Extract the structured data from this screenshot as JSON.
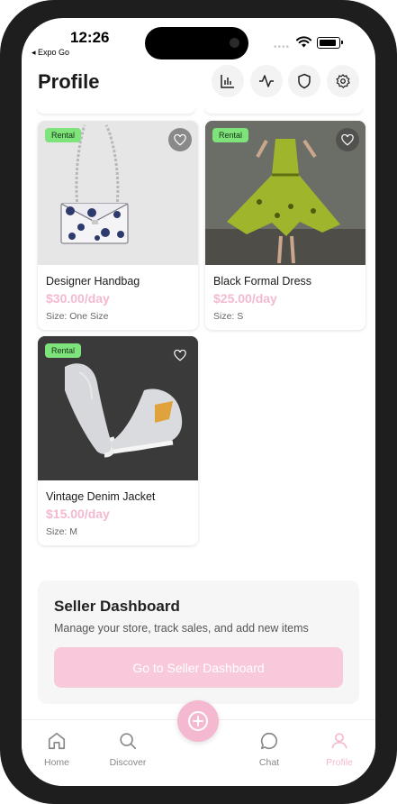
{
  "status": {
    "time": "12:26",
    "back_label": "◂ Expo Go"
  },
  "header": {
    "title": "Profile"
  },
  "products": [
    {
      "badge": "Rental",
      "name": "Designer Handbag",
      "price": "$30.00/day",
      "size": "Size: One Size"
    },
    {
      "badge": "Rental",
      "name": "Black Formal Dress",
      "price": "$25.00/day",
      "size": "Size: S"
    },
    {
      "badge": "Rental",
      "name": "Vintage Denim Jacket",
      "price": "$15.00/day",
      "size": "Size: M"
    }
  ],
  "seller": {
    "title": "Seller Dashboard",
    "description": "Manage your store, track sales, and add new items",
    "button": "Go to Seller Dashboard"
  },
  "tabbar": {
    "home": "Home",
    "discover": "Discover",
    "chat": "Chat",
    "profile": "Profile"
  },
  "colors": {
    "accent": "#f4b9d0",
    "badge": "#7ee37b"
  }
}
